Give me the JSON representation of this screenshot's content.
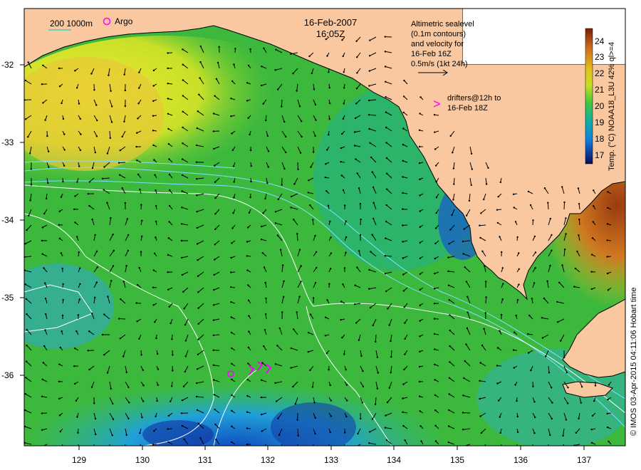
{
  "title": {
    "date": "16-Feb-2007",
    "time": "16:05Z"
  },
  "legend": {
    "depth_label": "200  1000m",
    "argo_label": "Argo",
    "altimetry_lines": [
      "Altimetric sealevel",
      "(0.1m contours)",
      "and velocity for",
      "16-Feb 16Z",
      "0.5m/s (1kt 24h)"
    ],
    "drifter_symbol": ">",
    "drifter_lines": [
      "drifters@12h to",
      "16-Feb 18Z"
    ]
  },
  "axes": {
    "x_ticks": [
      "129",
      "130",
      "131",
      "132",
      "133",
      "134",
      "135",
      "136",
      "137"
    ],
    "y_ticks": [
      "-32",
      "-33",
      "-34",
      "-35",
      "-36"
    ]
  },
  "colorbar": {
    "ticks": [
      "24",
      "23",
      "22",
      "21",
      "20",
      "19",
      "18",
      "17"
    ],
    "label": "Temp. (°C) NOAA18_L3U 42% ql>=4",
    "colors": [
      "#8b2b0f",
      "#d07020",
      "#e0c020",
      "#c8e020",
      "#40c840",
      "#10b0a0",
      "#1080e0",
      "#101070"
    ]
  },
  "credit": "© IMOS 03-Apr-2015 04:11:06 Hobart time",
  "colors": {
    "land": "#f9c8a0",
    "warm_sst": "#e8e030",
    "mid_sst": "#30b040",
    "cool_sst": "#20a0d0",
    "cold_sst": "#1030a0",
    "hot_sst": "#c06020",
    "drifter": "#ff00ff",
    "contour": "#ffffff",
    "altimetry": "#80e0ff"
  }
}
